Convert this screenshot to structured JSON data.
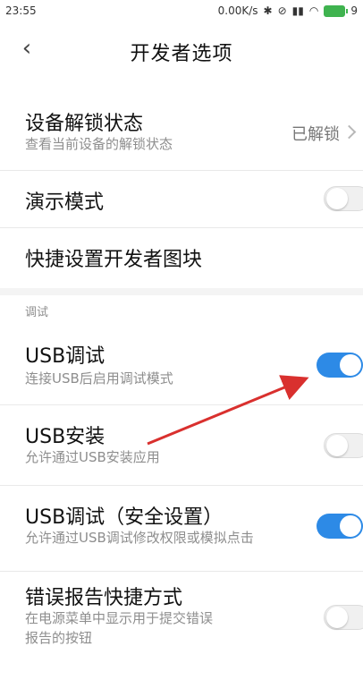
{
  "status_bar": {
    "time": "23:55",
    "network_speed": "0.00K/s",
    "battery_text": "9"
  },
  "header": {
    "back_icon": "chevron-left-icon",
    "title": "开发者选项"
  },
  "items": {
    "unlock_status": {
      "label": "设备解锁状态",
      "subtitle": "查看当前设备的解锁状态",
      "value": "已解锁"
    },
    "demo_mode": {
      "label": "演示模式",
      "toggle": "off"
    },
    "quick_tiles": {
      "label": "快捷设置开发者图块"
    }
  },
  "section_debug": {
    "header": "调试",
    "usb_debug": {
      "label": "USB调试",
      "subtitle": "连接USB后启用调试模式",
      "toggle": "on"
    },
    "usb_install": {
      "label": "USB安装",
      "subtitle": "允许通过USB安装应用",
      "toggle": "off"
    },
    "usb_debug_secure": {
      "label": "USB调试（安全设置）",
      "subtitle": "允许通过USB调试修改权限或模拟点击",
      "toggle": "on"
    },
    "bug_report_shortcut": {
      "label": "错误报告快捷方式",
      "subtitle_line1": "在电源菜单中显示用于提交错误",
      "subtitle_line2": "报告的按钮",
      "toggle": "off"
    }
  },
  "colors": {
    "accent": "#2d8ae6",
    "annotation_arrow": "#d9302e"
  }
}
